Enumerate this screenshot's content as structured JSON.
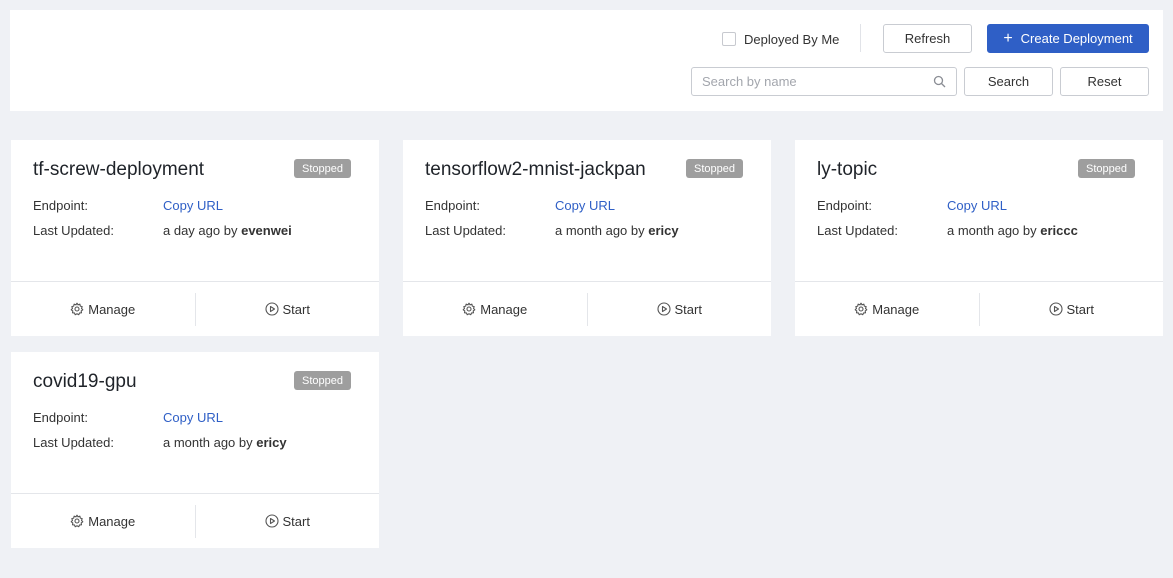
{
  "toolbar": {
    "deployed_by_me_label": "Deployed By Me",
    "refresh_label": "Refresh",
    "create_label": "Create Deployment",
    "search_placeholder": "Search by name",
    "search_label": "Search",
    "reset_label": "Reset"
  },
  "card_labels": {
    "endpoint": "Endpoint:",
    "last_updated": "Last Updated:",
    "copy_url": "Copy URL",
    "by": "by",
    "manage": "Manage",
    "start": "Start"
  },
  "deployments": [
    {
      "name": "tf-screw-deployment",
      "status": "Stopped",
      "updated_ago": "a day ago",
      "user": "evenwei"
    },
    {
      "name": "tensorflow2-mnist-jackpan",
      "status": "Stopped",
      "updated_ago": "a month ago",
      "user": "ericy"
    },
    {
      "name": "ly-topic",
      "status": "Stopped",
      "updated_ago": "a month ago",
      "user": "ericcc"
    },
    {
      "name": "covid19-gpu",
      "status": "Stopped",
      "updated_ago": "a month ago",
      "user": "ericy"
    }
  ],
  "colors": {
    "primary": "#2f5fc6",
    "badge_stopped": "#9e9e9e",
    "background": "#eff1f5"
  },
  "icons": {
    "search": "search-icon",
    "plus": "plus-icon",
    "manage": "gear-icon",
    "start": "play-circle-icon"
  }
}
